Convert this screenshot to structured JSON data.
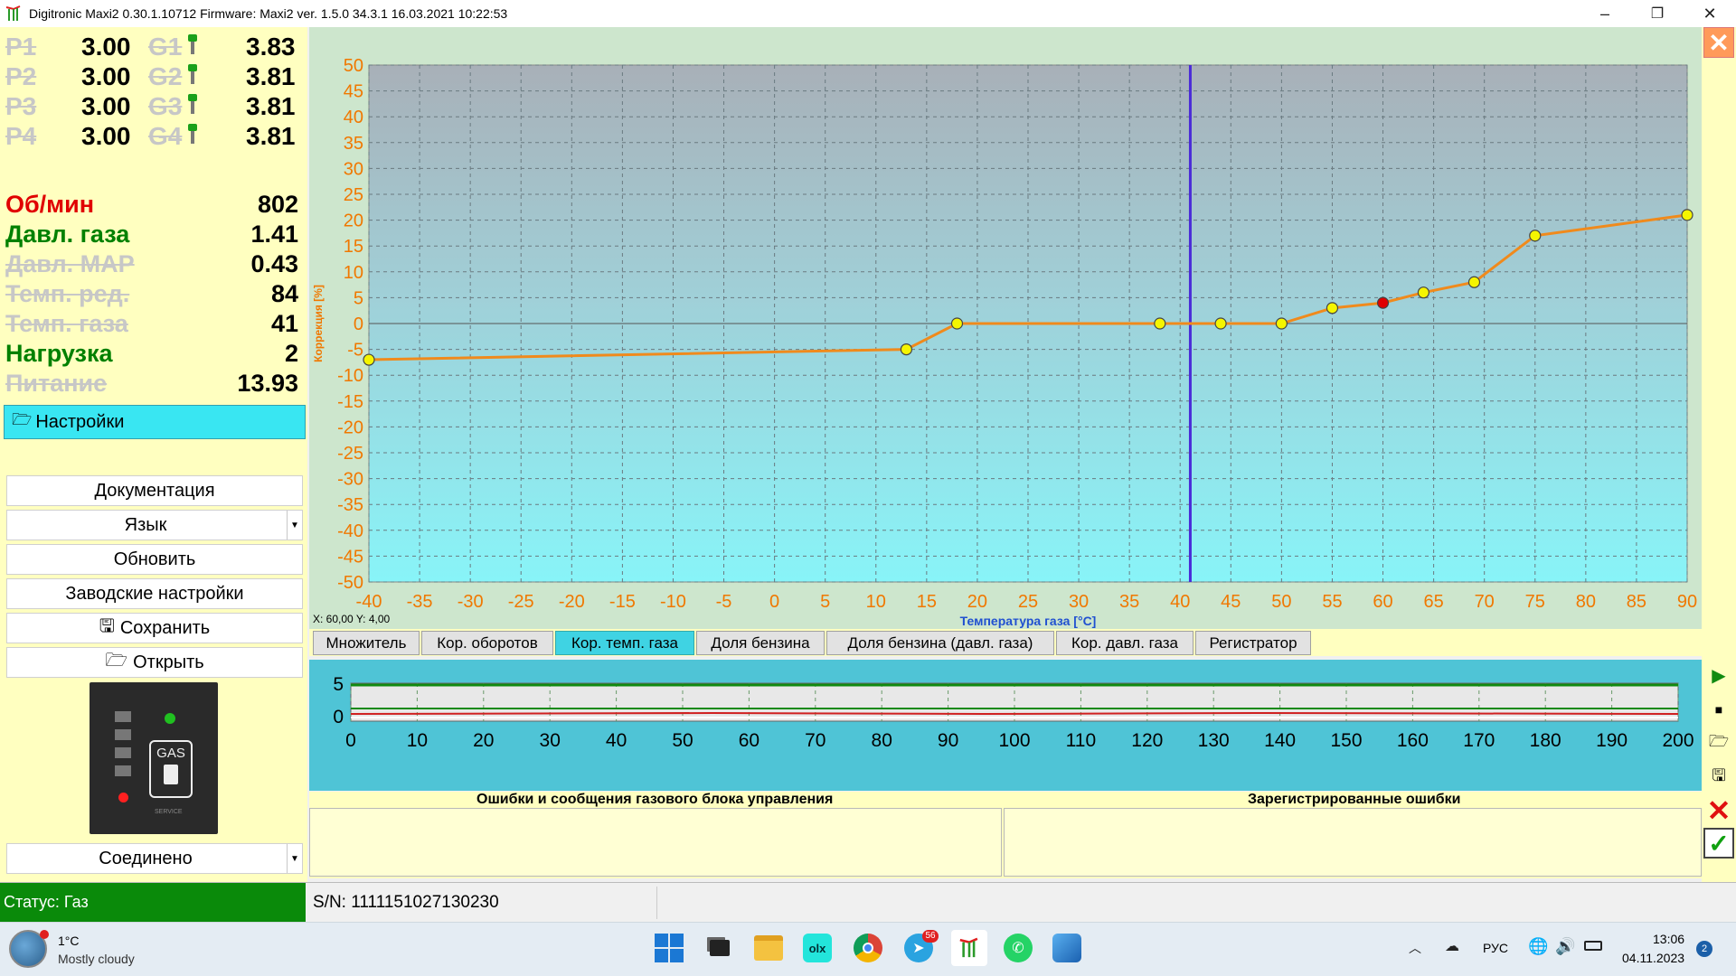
{
  "window": {
    "title": "Digitronic Maxi2 0.30.1.10712 Firmware: Maxi2  ver. 1.5.0  34.3.1   16.03.2021 10:22:53",
    "minimize": "–",
    "restore": "❐",
    "close": "✕"
  },
  "injectors": [
    {
      "p": "P1",
      "p_val": "3.00",
      "g": "G1",
      "g_val": "3.83"
    },
    {
      "p": "P2",
      "p_val": "3.00",
      "g": "G2",
      "g_val": "3.81"
    },
    {
      "p": "P3",
      "p_val": "3.00",
      "g": "G3",
      "g_val": "3.81"
    },
    {
      "p": "P4",
      "p_val": "3.00",
      "g": "G4",
      "g_val": "3.81"
    }
  ],
  "params": [
    {
      "label": "Об/мин",
      "value": "802",
      "color": "#e00000",
      "strike": false
    },
    {
      "label": "Давл. газа",
      "value": "1.41",
      "color": "#008000",
      "strike": false
    },
    {
      "label": "Давл. МАР",
      "value": "0.43",
      "color": "#c7c7c7",
      "strike": true
    },
    {
      "label": "Темп. ред.",
      "value": "84",
      "color": "#c7c7c7",
      "strike": true
    },
    {
      "label": "Темп. газа",
      "value": "41",
      "color": "#c7c7c7",
      "strike": true
    },
    {
      "label": "Нагрузка",
      "value": "2",
      "color": "#008000",
      "strike": false
    },
    {
      "label": "Питание",
      "value": "13.93",
      "color": "#c7c7c7",
      "strike": true
    }
  ],
  "settings_header": "Настройки",
  "buttons": {
    "documentation": "Документация",
    "language": "Язык",
    "refresh": "Обновить",
    "factory": "Заводские настройки",
    "save": "Сохранить",
    "open": "Открыть",
    "connection": "Соединено"
  },
  "ecu_image": {
    "label": "GAS",
    "sublabel": "SERVICE"
  },
  "chart_data": {
    "type": "line",
    "xlabel": "Температура газа [°C]",
    "ylabel": "Коррекция [%]",
    "xlim": [
      -40,
      90
    ],
    "ylim": [
      -50,
      50
    ],
    "x_ticks": [
      -40,
      -35,
      -30,
      -25,
      -20,
      -15,
      -10,
      -5,
      0,
      5,
      10,
      15,
      20,
      25,
      30,
      35,
      40,
      45,
      50,
      55,
      60,
      65,
      70,
      75,
      80,
      85,
      90
    ],
    "y_ticks": [
      50,
      45,
      40,
      35,
      30,
      25,
      20,
      15,
      10,
      5,
      0,
      -5,
      -10,
      -15,
      -20,
      -25,
      -30,
      -35,
      -40,
      -45,
      -50
    ],
    "points": [
      {
        "x": -40,
        "y": -7
      },
      {
        "x": 13,
        "y": -5
      },
      {
        "x": 18,
        "y": 0
      },
      {
        "x": 38,
        "y": 0
      },
      {
        "x": 44,
        "y": 0
      },
      {
        "x": 50,
        "y": 0
      },
      {
        "x": 55,
        "y": 3
      },
      {
        "x": 60,
        "y": 4
      },
      {
        "x": 64,
        "y": 6
      },
      {
        "x": 69,
        "y": 8
      },
      {
        "x": 75,
        "y": 17
      },
      {
        "x": 90,
        "y": 21
      }
    ],
    "selected_x": 60,
    "cursor_x": 41,
    "colors": {
      "line": "#f08a1c",
      "point": "#f5f500",
      "selected": "#e00000",
      "cursor": "#4a2bd8",
      "axis_text": "#f07800"
    },
    "readout": "X: 60,00  Y: 4,00"
  },
  "tabs": [
    {
      "label": "Множитель",
      "active": false
    },
    {
      "label": "Кор. оборотов",
      "active": false
    },
    {
      "label": "Кор. темп. газа",
      "active": true
    },
    {
      "label": "Доля бензина",
      "active": false
    },
    {
      "label": "Доля бензина (давл. газа)",
      "active": false
    },
    {
      "label": "Кор. давл. газа",
      "active": false
    },
    {
      "label": "Регистратор",
      "active": false
    }
  ],
  "strip": {
    "y_top": "5",
    "y_bottom": "0",
    "x_ticks": [
      "0",
      "10",
      "20",
      "30",
      "40",
      "50",
      "60",
      "70",
      "80",
      "90",
      "100",
      "110",
      "120",
      "130",
      "140",
      "150",
      "160",
      "170",
      "180",
      "190",
      "200"
    ]
  },
  "errors": {
    "left_title": "Ошибки и сообщения газового блока управления",
    "right_title": "Зарегистрированные ошибки"
  },
  "status": {
    "text": "Статус: Газ",
    "serial": "S/N: 1111151027130230"
  },
  "taskbar": {
    "weather_temp": "1°C",
    "weather_desc": "Mostly cloudy",
    "lang": "РУС",
    "time": "13:06",
    "date": "04.11.2023",
    "notif_count": "2",
    "telegram_badge": "56"
  }
}
